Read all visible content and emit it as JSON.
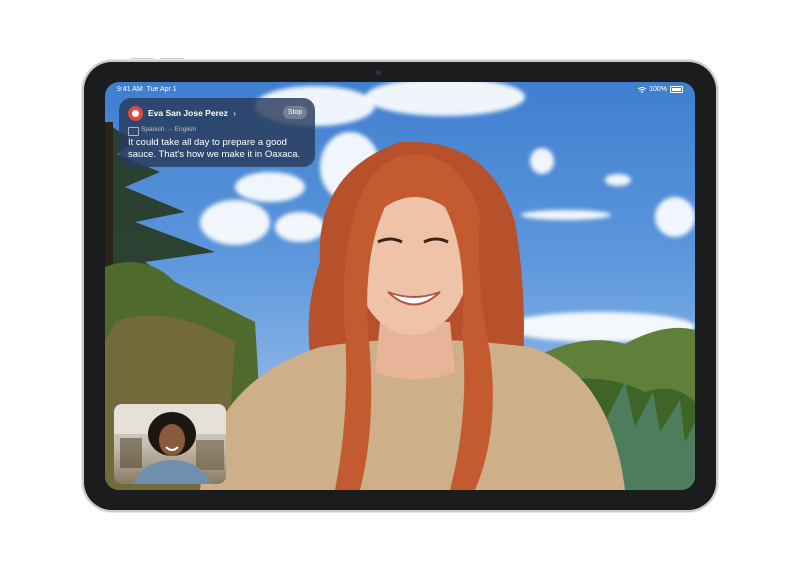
{
  "status_bar": {
    "time": "9:41 AM",
    "date": "Tue Apr 1",
    "battery": "100%"
  },
  "live_translation": {
    "caller_name": "Eva San Jose Perez",
    "caller_chevron": "›",
    "stop_label": "Stop",
    "source_language": "Spanish",
    "arrow": "→",
    "target_language": "English",
    "caption": "It could take all day to prepare a good sauce. That's how we make it in Oaxaca."
  },
  "icons": {
    "avatar": "avatar-icon",
    "translate": "translate-icon",
    "wifi": "wifi-icon",
    "battery": "battery-icon"
  },
  "colors": {
    "frame": "#1b1c1e",
    "caption_card": "#283a5a",
    "avatar": "#e0473f",
    "sky": "#3f7fd0"
  }
}
